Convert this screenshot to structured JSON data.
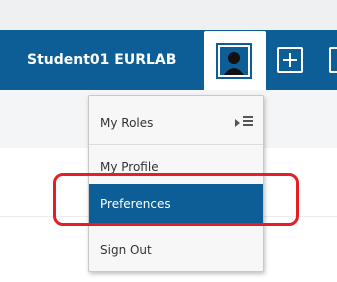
{
  "header": {
    "username": "Student01 EURLAB",
    "user_icon": "user-avatar-icon",
    "add_icon": "plus-icon"
  },
  "user_menu": {
    "items": [
      {
        "label": "My Roles",
        "icon": "chevron-list-icon"
      },
      {
        "label": "My Profile"
      },
      {
        "label": "Preferences",
        "selected": true
      },
      {
        "label": "Sign Out"
      }
    ]
  },
  "colors": {
    "brand": "#0d5e96",
    "highlight": "#e41e25"
  }
}
